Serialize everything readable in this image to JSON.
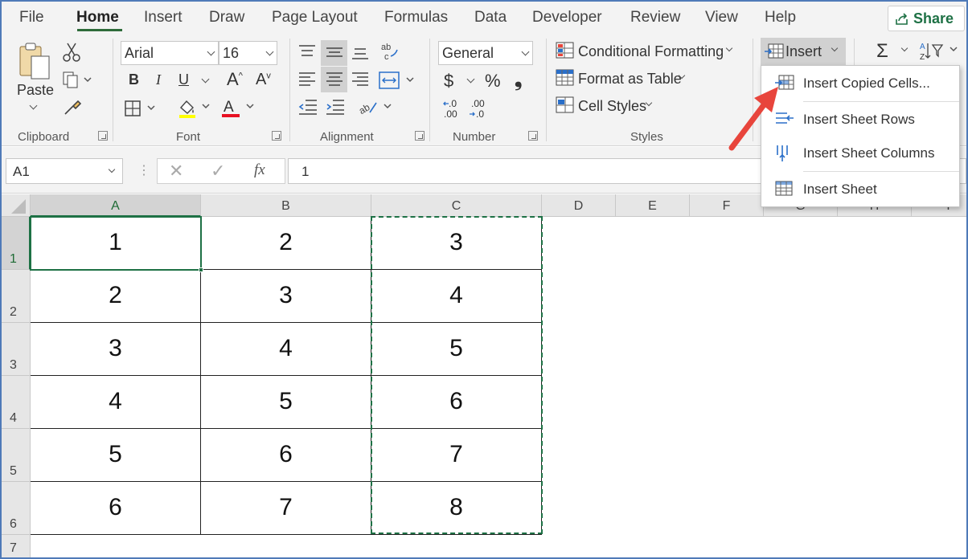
{
  "tabs": [
    "File",
    "Home",
    "Insert",
    "Draw",
    "Page Layout",
    "Formulas",
    "Data",
    "Developer",
    "Review",
    "View",
    "Help"
  ],
  "share_label": "Share",
  "clipboard": {
    "paste_label": "Paste",
    "group_label": "Clipboard"
  },
  "font": {
    "name": "Arial",
    "size": "16",
    "group_label": "Font"
  },
  "alignment": {
    "group_label": "Alignment"
  },
  "number": {
    "format": "General",
    "currency": "$",
    "percent": "%",
    "comma": "❟",
    "inc_decimal": "←.0\n.00",
    "dec_decimal": ".00\n→.0",
    "group_label": "Number"
  },
  "styles": {
    "conditional": "Conditional Formatting",
    "format_table": "Format as Table",
    "cell_styles": "Cell Styles",
    "group_label": "Styles"
  },
  "cells": {
    "insert_label": "Insert"
  },
  "editing": {
    "sum": "Σ",
    "sort": "A Z"
  },
  "formula_bar": {
    "name_box": "A1",
    "fx": "fx",
    "content": "1"
  },
  "columns": [
    "A",
    "B",
    "C",
    "D",
    "E",
    "F",
    "G",
    "H",
    "I"
  ],
  "rows": [
    "1",
    "2",
    "3",
    "4",
    "5",
    "6",
    "7"
  ],
  "cells_data": [
    [
      "1",
      "2",
      "3"
    ],
    [
      "2",
      "3",
      "4"
    ],
    [
      "3",
      "4",
      "5"
    ],
    [
      "4",
      "5",
      "6"
    ],
    [
      "5",
      "6",
      "7"
    ],
    [
      "6",
      "7",
      "8"
    ]
  ],
  "insert_menu": [
    {
      "label": "Insert Copied Cells...",
      "icon": "insert-copied-cells-icon"
    },
    {
      "label": "Insert Sheet Rows",
      "icon": "insert-rows-icon"
    },
    {
      "label": "Insert Sheet Columns",
      "icon": "insert-columns-icon"
    },
    {
      "label": "Insert Sheet",
      "icon": "insert-sheet-icon"
    }
  ],
  "colors": {
    "accent_green": "#1e7145",
    "arrow_red": "#e8453c",
    "font_color_red": "#e81123"
  }
}
